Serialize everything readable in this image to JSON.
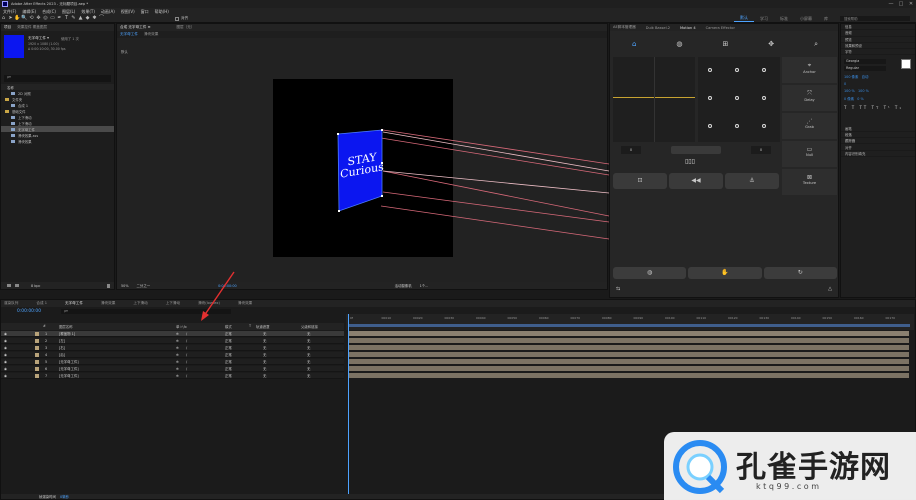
{
  "window": {
    "title": "Adobe After Effects 2023 - 无标题项目.aep *",
    "controls": [
      "—",
      "□",
      "✕"
    ]
  },
  "menu": [
    "文件(F)",
    "编辑(E)",
    "合成(C)",
    "图层(L)",
    "效果(T)",
    "动画(A)",
    "视图(V)",
    "窗口",
    "帮助(H)"
  ],
  "toolbar": {
    "tools": [
      "⌂",
      "➤",
      "✋",
      "🔍",
      "⟲",
      "✥",
      "◎",
      "▭",
      "✒",
      "T",
      "✎",
      "▲",
      "◆",
      "✱",
      "⌒"
    ],
    "snap_label": "对齐",
    "workspaces": [
      "默认",
      "学习",
      "标准",
      "小屏幕",
      "库"
    ],
    "active_workspace": "默认",
    "search_placeholder": "搜索帮助"
  },
  "project": {
    "tabs": [
      "项目",
      "效果控件 覆盖图层"
    ],
    "item_name": "无字母工件 ▾",
    "item_used": "使用了 1 次",
    "item_info1": "1920 x 1080 (1.00)",
    "item_info2": "Δ 0:00:10:00, 30.00 fps",
    "search_placeholder": "ρ▾",
    "column_name": "名称",
    "items": [
      {
        "label": "2D 对照",
        "type": "comp",
        "selected": false
      },
      {
        "label": "文件夹",
        "type": "folder",
        "selected": false
      },
      {
        "label": "合成 1",
        "type": "comp",
        "selected": false
      },
      {
        "label": "基础文件",
        "type": "folder",
        "selected": false
      },
      {
        "label": "上下滑动",
        "type": "comp",
        "selected": false
      },
      {
        "label": "上下滑动",
        "type": "comp",
        "selected": false
      },
      {
        "label": "无字母工件",
        "type": "comp",
        "selected": true
      },
      {
        "label": "滑块效果-sss",
        "type": "comp",
        "selected": false
      },
      {
        "label": "滑块效果",
        "type": "comp",
        "selected": false
      }
    ],
    "footer_bpc": "8 bpc"
  },
  "composition": {
    "header": "合成 无字母工件 ≡",
    "tabs": [
      "无字母工件",
      "滑块效果",
      "上下滑动",
      "上下滑动",
      "滑块效果",
      "滑块效果"
    ],
    "active_tab": "无字母工件",
    "layer_label": "图层（无）",
    "sublabel": "默认",
    "card_text_line1": "STAY",
    "card_text_line2": "Curious",
    "footer": {
      "zoom": "50%",
      "quality": "二分之一",
      "timecode": "0:00:00:00",
      "camera": "活动摄像机",
      "views": "1个..."
    }
  },
  "right_panel": {
    "tabs": [
      "AE脚本管理器",
      "Duik Bassel.2",
      "Motion 4",
      "Camera Effector"
    ],
    "active_tab": "Motion 4",
    "side_labels": [
      "Anchor",
      "Delay",
      "Grab",
      "Null",
      "Texture"
    ],
    "value_left": "0",
    "value_right": "0"
  },
  "far_right": {
    "items": [
      "信息",
      "音频",
      "预览",
      "效果和预设",
      "字符"
    ],
    "font_name": "Georgia",
    "font_style": "Regular",
    "font_size": "100 像素",
    "leading": "自动",
    "tracking": "0",
    "scale_v": "100 %",
    "scale_h": "100 %",
    "baseline": "0 像素",
    "tsume": "0 %",
    "bottom_items": [
      "画笔",
      "段落",
      "跟踪器",
      "对齐",
      "内容识别填充"
    ]
  },
  "timeline": {
    "tabs": [
      "渲染队列",
      "合成 1",
      "无字母工件",
      "滑块效果",
      "上下滑动",
      "上下滑动",
      "滑块(lowtex)",
      "滑块效果"
    ],
    "active_tab": "无字母工件",
    "timecode": "0:00:00:00",
    "search_placeholder": "ρ▾",
    "columns": [
      "#",
      "图层名称",
      "单☆\\fx",
      "模式",
      "T",
      "轨道遮罩",
      "父级和链接"
    ],
    "ruler_marks": [
      "0f",
      "00010",
      "00020",
      "00030",
      "00040",
      "00050",
      "00060",
      "00070",
      "00080",
      "00090",
      "00100",
      "00110",
      "00120",
      "00130",
      "00140",
      "00150",
      "00160",
      "00170"
    ],
    "layers": [
      {
        "index": "1",
        "name": "[覆盖物 1]",
        "mode": "正常",
        "matte": "无",
        "parent": "无",
        "selected": true
      },
      {
        "index": "2",
        "name": "[左]",
        "mode": "正常",
        "matte": "无",
        "parent": "无",
        "selected": false
      },
      {
        "index": "3",
        "name": "[右]",
        "mode": "正常",
        "matte": "无",
        "parent": "无",
        "selected": false
      },
      {
        "index": "4",
        "name": "[后]",
        "mode": "正常",
        "matte": "无",
        "parent": "无",
        "selected": false
      },
      {
        "index": "5",
        "name": "[无字母工件]",
        "mode": "正常",
        "matte": "无",
        "parent": "无",
        "selected": false
      },
      {
        "index": "6",
        "name": "[无字母工件]",
        "mode": "正常",
        "matte": "无",
        "parent": "无",
        "selected": false
      },
      {
        "index": "7",
        "name": "[无字母工件]",
        "mode": "正常",
        "matte": "无",
        "parent": "无",
        "selected": false
      }
    ],
    "footer_label": "帧渲染时间",
    "footer_value": "0毫秒"
  },
  "watermark": {
    "brand": "孔雀手游网",
    "url": "k t q 9 9 . c o m",
    "colors": {
      "main": "#ffffff",
      "accent": "#2a8bf2"
    }
  },
  "colors": {
    "accent_blue": "#2d8cf0",
    "comp_blue": "#0b16f0",
    "timeline_bar": "#7c7364",
    "annotation_arrow": "#e33030"
  }
}
